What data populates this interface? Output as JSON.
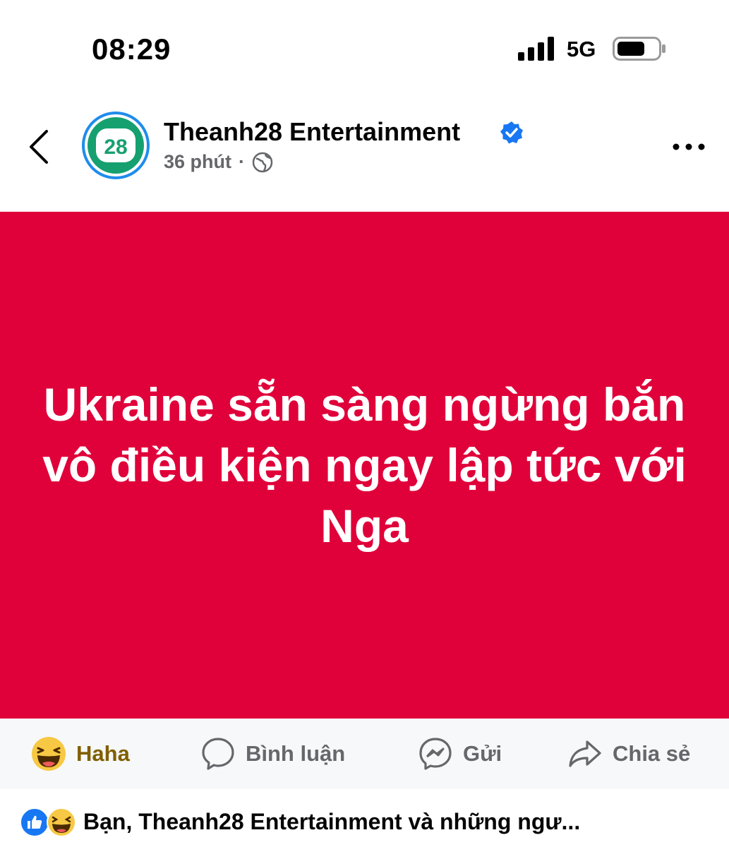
{
  "status_bar": {
    "time": "08:29",
    "network": "5G",
    "signal_icon": "signal-bars-icon",
    "battery_icon": "battery-icon"
  },
  "post": {
    "page_name": "Theanh28 Entertainment",
    "avatar_text": "28",
    "time_ago": "36 phút",
    "separator": "·",
    "audience_icon": "globe-icon",
    "verified_icon": "verified-badge-icon",
    "image_headline": "Ukraine sẵn sàng ngừng bắn vô điều kiện ngay lập tức với Nga",
    "image_background": "#e0003a"
  },
  "actions": {
    "haha_label": "Haha",
    "comment_label": "Bình luận",
    "send_label": "Gửi",
    "share_label": "Chia sẻ"
  },
  "reactions": {
    "summary": "Bạn, Theanh28 Entertainment và những ngư..."
  },
  "colors": {
    "accent": "#1877f2",
    "muted_text": "#65676b",
    "haha_text": "#806000"
  }
}
